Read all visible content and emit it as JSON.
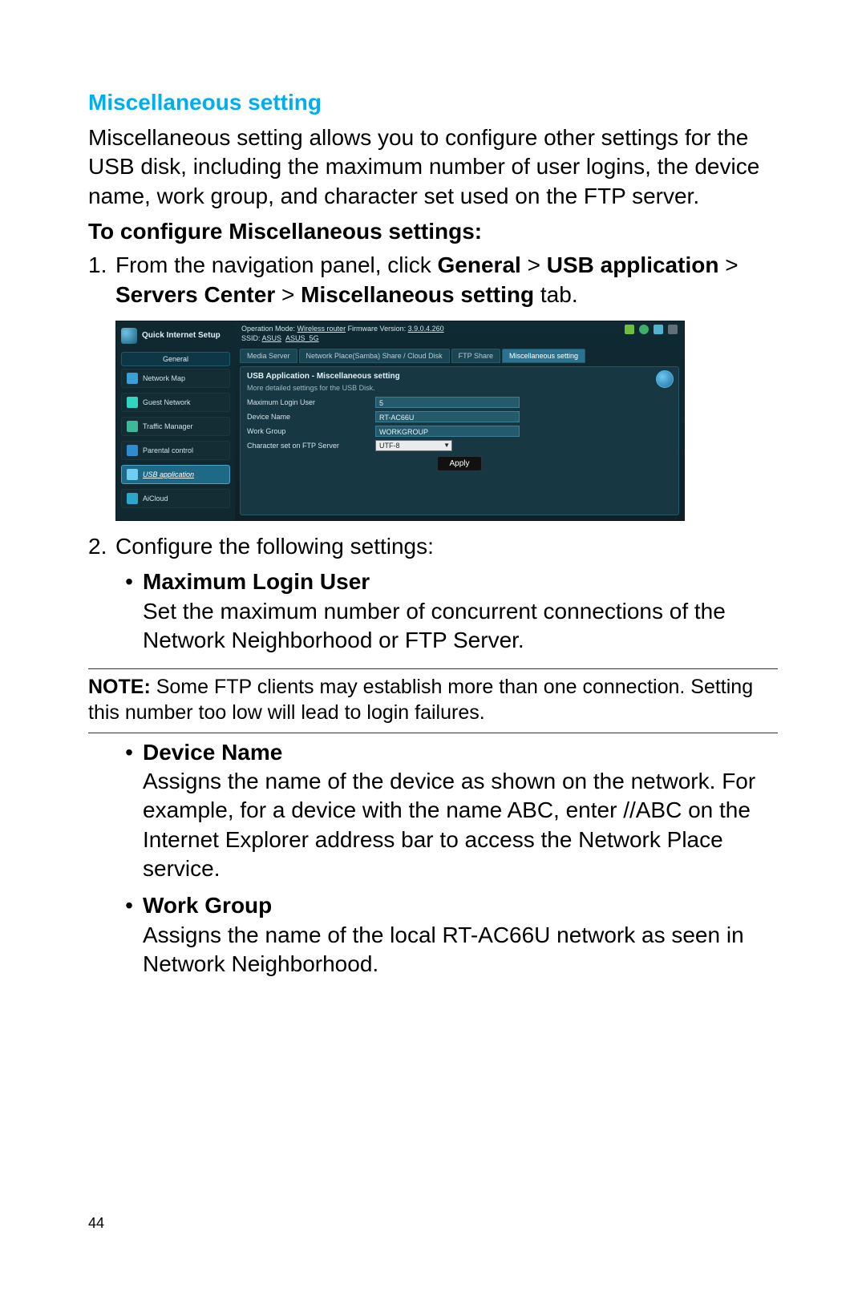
{
  "page_number": "44",
  "section_title": "Miscellaneous setting",
  "intro": "Miscellaneous setting allows you to configure other settings for the USB disk, including the maximum number of user logins, the device name, work group, and character set used on the FTP server.",
  "subhead": "To configure Miscellaneous settings:",
  "step1": {
    "num": "1.",
    "prefix": "From the navigation panel, click ",
    "b1": "General",
    "s1": " > ",
    "b2": "USB application",
    "s2": " > ",
    "b3": "Servers Center",
    "s3": " > ",
    "b4": "Miscellaneous setting",
    "suffix": " tab."
  },
  "screenshot": {
    "qis": "Quick Internet Setup",
    "general": "General",
    "nav": {
      "network_map": "Network Map",
      "guest_network": "Guest Network",
      "traffic_manager": "Traffic Manager",
      "parental_control": "Parental control",
      "usb_application": "USB application",
      "aicloud": "AiCloud"
    },
    "top": {
      "opmode_label": "Operation Mode: ",
      "opmode_value": "Wireless router",
      "fw_label": "   Firmware Version: ",
      "fw_value": "3.9.0.4.260",
      "ssid_label": "SSID: ",
      "ssid1": "ASUS",
      "ssid2": "ASUS_5G"
    },
    "tabs": {
      "media": "Media Server",
      "samba": "Network Place(Samba) Share / Cloud Disk",
      "ftp": "FTP Share",
      "misc": "Miscellaneous setting"
    },
    "panel": {
      "title": "USB Application - Miscellaneous setting",
      "sub": "More detailed settings for the USB Disk.",
      "rows": {
        "max_label": "Maximum Login User",
        "max_value": "5",
        "dev_label": "Device Name",
        "dev_value": "RT-AC66U",
        "wg_label": "Work Group",
        "wg_value": "WORKGROUP",
        "cs_label": "Character set on FTP Server",
        "cs_value": "UTF-8"
      },
      "apply": "Apply"
    }
  },
  "step2": {
    "num": "2.",
    "text": "Configure the following settings:"
  },
  "bullets": {
    "b1_title": "Maximum Login User",
    "b1_desc": "Set the maximum number of concurrent connections of the Network Neighborhood or FTP Server.",
    "b2_title": "Device Name",
    "b2_desc": "Assigns the name of the device as shown on the network. For example, for a device with the name ABC, enter //ABC on the Internet Explorer address bar to access the Network Place service.",
    "b3_title": "Work Group",
    "b3_desc": "Assigns the name of the local RT-AC66U network as seen in Network Neighborhood."
  },
  "note": {
    "label": "NOTE:",
    "text": " Some FTP clients may establish more than one connection. Setting this number too low will lead to login failures."
  }
}
